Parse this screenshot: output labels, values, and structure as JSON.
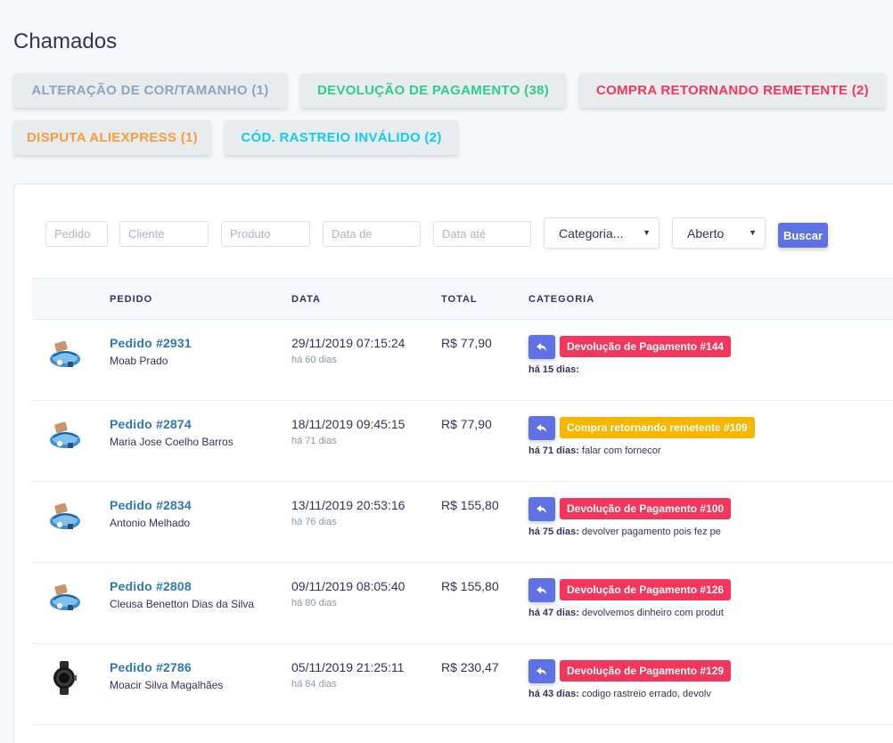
{
  "page_title": "Chamados",
  "categories": [
    {
      "label": "Alteração de cor/tamanho (1)",
      "color": "#8fa3bf"
    },
    {
      "label": "Devolução de pagamento (38)",
      "color": "#2dce89"
    },
    {
      "label": "Compra retornando remetente (2)",
      "color": "#f5365c"
    },
    {
      "label": "Disputa aliexpress (1)",
      "color": "#fb9c3c"
    },
    {
      "label": "Cód. rastreio inválido (2)",
      "color": "#11cdef"
    }
  ],
  "filters": {
    "pedido_placeholder": "Pedido",
    "cliente_placeholder": "Cliente",
    "produto_placeholder": "Produto",
    "data_de_placeholder": "Data de",
    "data_ate_placeholder": "Data até",
    "categoria_value": "Categoria...",
    "status_value": "Aberto",
    "search_label": "Buscar"
  },
  "table": {
    "headers": {
      "pedido": "Pedido",
      "data": "Data",
      "total": "Total",
      "categoria": "Categoria"
    },
    "rows": [
      {
        "order": "Pedido #2931",
        "customer": "Moab Prado",
        "date": "29/11/2019 07:15:24",
        "ago": "há 60 dias",
        "total": "R$ 77,90",
        "badge": "Devolução de Pagamento #144",
        "badge_color": "#f5365c",
        "note_days": "há 15 dias:",
        "note_text": "",
        "product": "sandal-blue"
      },
      {
        "order": "Pedido #2874",
        "customer": "Maria Jose Coelho Barros",
        "date": "18/11/2019 09:45:15",
        "ago": "há 71 dias",
        "total": "R$ 77,90",
        "badge": "Compra retornando remetente #109",
        "badge_color": "#f7b600",
        "note_days": "há 71 dias:",
        "note_text": "falar com fornecor",
        "product": "sandal-blue"
      },
      {
        "order": "Pedido #2834",
        "customer": "Antonio Melhado",
        "date": "13/11/2019 20:53:16",
        "ago": "há 76 dias",
        "total": "R$ 155,80",
        "badge": "Devolução de Pagamento #100",
        "badge_color": "#f5365c",
        "note_days": "há 75 dias:",
        "note_text": "devolver pagamento pois fez pe",
        "product": "sandal-blue"
      },
      {
        "order": "Pedido #2808",
        "customer": "Cleusa Benetton Dias da Silva",
        "date": "09/11/2019 08:05:40",
        "ago": "há 80 dias",
        "total": "R$ 155,80",
        "badge": "Devolução de Pagamento #126",
        "badge_color": "#f5365c",
        "note_days": "há 47 dias:",
        "note_text": "devolvemos dinheiro com produt",
        "product": "sandal-blue"
      },
      {
        "order": "Pedido #2786",
        "customer": "Moacir Silva Magalhães",
        "date": "05/11/2019 21:25:11",
        "ago": "há 84 dias",
        "total": "R$ 230,47",
        "badge": "Devolução de Pagamento #129",
        "badge_color": "#f5365c",
        "note_days": "há 43 dias:",
        "note_text": "codigo rastreio errado, devolv",
        "product": "smartwatch-black"
      }
    ]
  }
}
